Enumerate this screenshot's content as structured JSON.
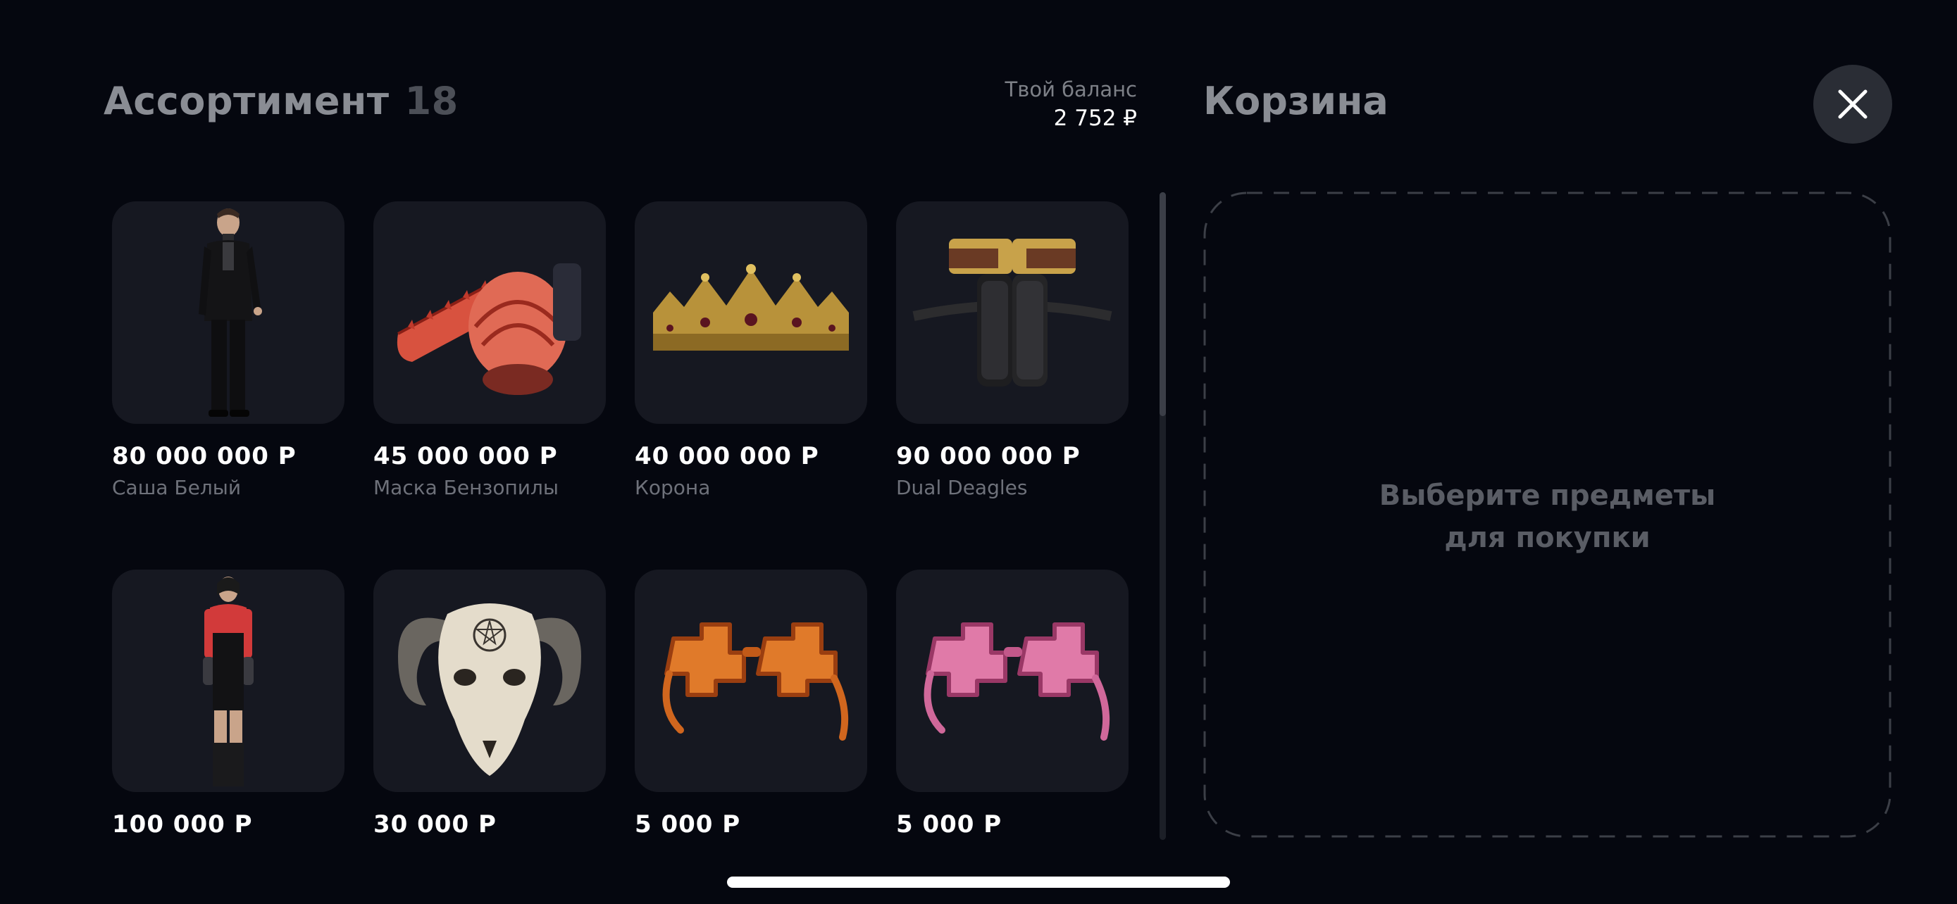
{
  "header": {
    "assortment_title": "Ассортимент",
    "assortment_count": "18",
    "balance_label": "Твой баланс",
    "balance_value": "2 752 ₽",
    "cart_title": "Корзина"
  },
  "close_icon": "close-icon",
  "items": [
    {
      "price": "80 000 000 Р",
      "name": "Саша Белый",
      "icon": "character-black-suit"
    },
    {
      "price": "45 000 000 Р",
      "name": "Маска Бензопилы",
      "icon": "chainsaw-mask"
    },
    {
      "price": "40 000 000 Р",
      "name": "Корона",
      "icon": "crown"
    },
    {
      "price": "90 000 000 Р",
      "name": "Dual Deagles",
      "icon": "dual-pistols-holster"
    },
    {
      "price": "100 000 Р",
      "name": "",
      "icon": "character-red-top"
    },
    {
      "price": "30 000 Р",
      "name": "",
      "icon": "ram-skull"
    },
    {
      "price": "5 000 Р",
      "name": "",
      "icon": "orange-cross-glasses"
    },
    {
      "price": "5 000 Р",
      "name": "",
      "icon": "pink-cross-glasses"
    }
  ],
  "cart": {
    "empty_line1": "Выберите предметы",
    "empty_line2": "для покупки"
  },
  "colors": {
    "background": "#05070f",
    "card": "#161821",
    "muted_title": "#8a8d94",
    "close_button": "#2a2d35"
  }
}
